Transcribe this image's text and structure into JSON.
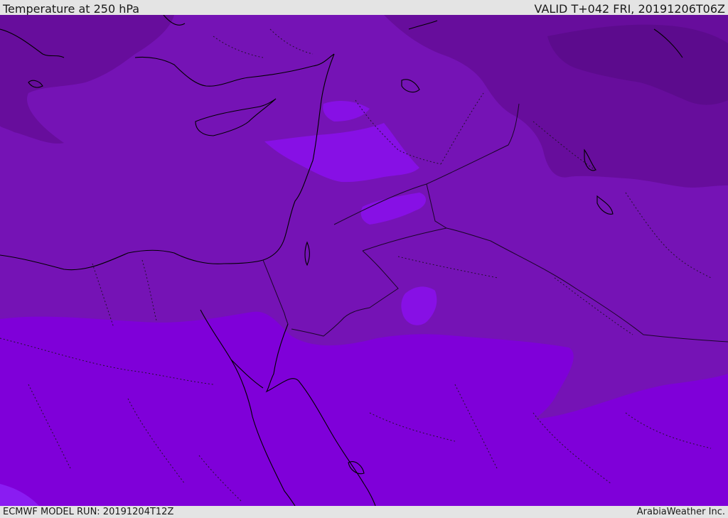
{
  "header": {
    "title": "Temperature at 250 hPa",
    "valid": "VALID T+042 FRI, 20191206T06Z"
  },
  "footer": {
    "model_run": "ECMWF MODEL RUN: 20191204T12Z",
    "credit": "ArabiaWeather Inc."
  },
  "map": {
    "colors": {
      "warm_band": "#7f00d9",
      "mid_band": "#7513b5",
      "cool_band": "#670d9c",
      "cold_band": "#5c0b8d",
      "bright_patch": "#8710e5",
      "coast_line": "#000000",
      "border_line": "#2a0b3a"
    }
  }
}
